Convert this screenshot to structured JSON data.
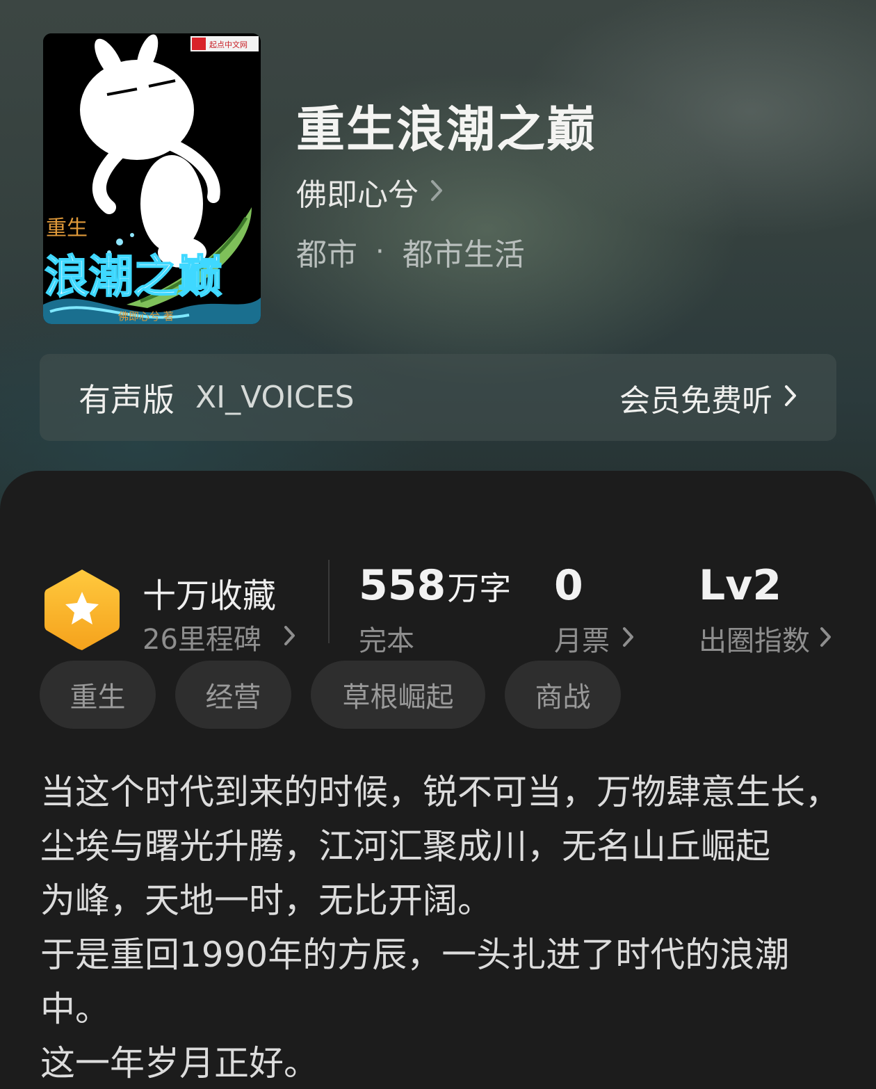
{
  "book": {
    "title": "重生浪潮之巅",
    "author": "佛即心兮",
    "genre": "都市",
    "subgenre": "都市生活",
    "genre_separator": "·"
  },
  "cover": {
    "publisher_badge": "起点中文网",
    "small_title": "重生",
    "big_title": "浪潮之巅",
    "author_credit": "佛即心兮 著"
  },
  "audio": {
    "label": "有声版",
    "narrator": "XI_VOICES",
    "cta": "会员免费听"
  },
  "stats": {
    "favorites": "十万收藏",
    "milestones": "26里程碑",
    "word_count": "558",
    "word_unit": "万字",
    "status": "完本",
    "monthly_votes": "0",
    "monthly_votes_label": "月票",
    "level": "Lv2",
    "level_label": "出圈指数"
  },
  "tags": [
    "重生",
    "经营",
    "草根崛起",
    "商战"
  ],
  "description": [
    "当这个时代到来的时候，锐不可当，万物肆意生长，",
    "尘埃与曙光升腾，江河汇聚成川，无名山丘崛起",
    "为峰，天地一时，无比开阔。",
    "于是重回1990年的方辰，一头扎进了时代的浪潮",
    "中。",
    "这一年岁月正好。"
  ],
  "colors": {
    "accent_badge": "#f5b52a",
    "panel_bg": "#1c1c1c",
    "tag_bg": "#2e2e2e"
  }
}
